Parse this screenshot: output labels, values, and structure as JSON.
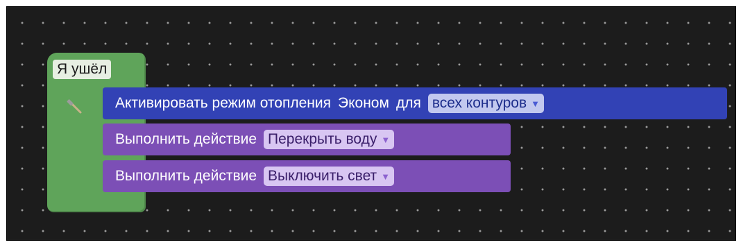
{
  "hat": {
    "label": "Я ушёл"
  },
  "blocks": [
    {
      "text": "Активировать режим отопления",
      "mode": "Эконом",
      "for_label": "для",
      "dropdown": "всех контуров"
    },
    {
      "text": "Выполнить действие",
      "dropdown": "Перекрыть воду"
    },
    {
      "text": "Выполнить действие",
      "dropdown": "Выключить свет"
    }
  ],
  "icons": {
    "hat_icon": "hammer-icon",
    "dropdown_icon": "triangle-down-icon"
  },
  "colors": {
    "workspace_bg": "#1c1c1c",
    "hat_block": "#5fa45a",
    "heating_block": "#3242b5",
    "action_block": "#7c4fb6"
  }
}
